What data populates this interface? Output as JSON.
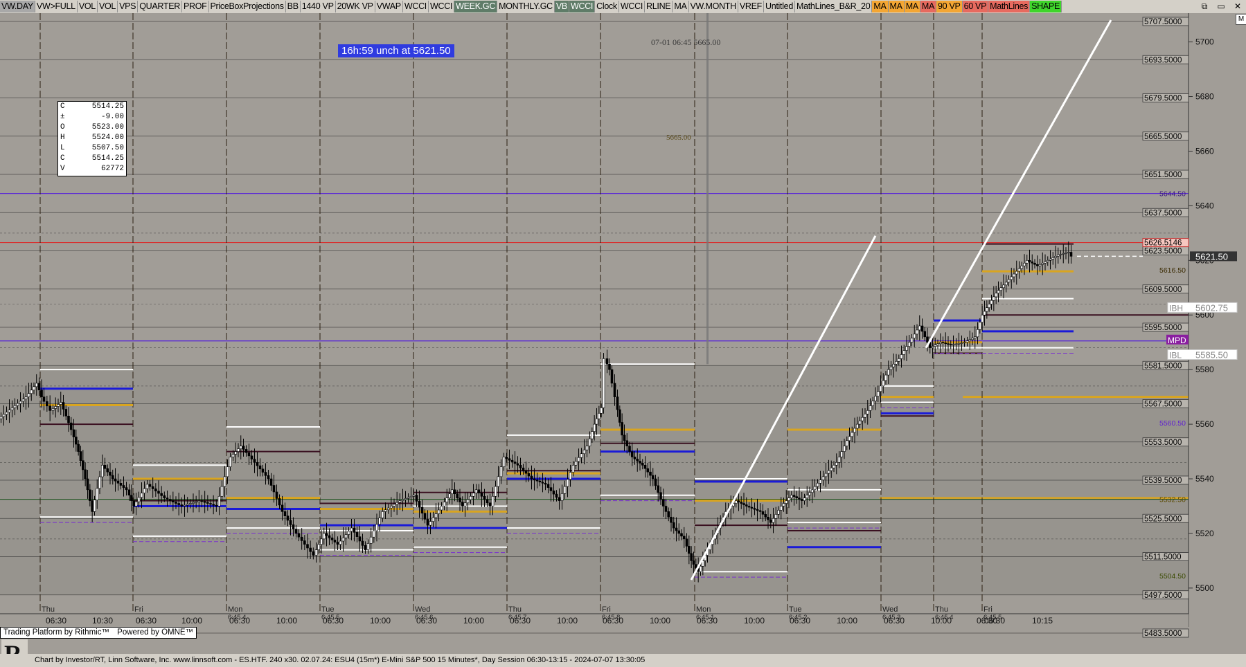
{
  "toolbar": {
    "buttons": [
      {
        "label": "VW.DAY",
        "style": "first"
      },
      {
        "label": "VW>FULL",
        "style": ""
      },
      {
        "label": "VOL",
        "style": ""
      },
      {
        "label": "VOL",
        "style": ""
      },
      {
        "label": "VPS",
        "style": ""
      },
      {
        "label": "QUARTER",
        "style": ""
      },
      {
        "label": "PROF",
        "style": ""
      },
      {
        "label": "PriceBoxProjections",
        "style": ""
      },
      {
        "label": "BB",
        "style": ""
      },
      {
        "label": "1440 VP",
        "style": ""
      },
      {
        "label": "20WK VP",
        "style": ""
      },
      {
        "label": "VWAP",
        "style": ""
      },
      {
        "label": "WCCI",
        "style": ""
      },
      {
        "label": "WCCI",
        "style": ""
      },
      {
        "label": "WEEK.GC",
        "style": "sel"
      },
      {
        "label": "MONTHLY.GC",
        "style": ""
      },
      {
        "label": "VB",
        "style": "sel"
      },
      {
        "label": "WCCI",
        "style": "sel"
      },
      {
        "label": "Clock",
        "style": ""
      },
      {
        "label": "WCCI",
        "style": ""
      },
      {
        "label": "RLINE",
        "style": ""
      },
      {
        "label": "MA",
        "style": ""
      },
      {
        "label": "VW.MONTH",
        "style": ""
      },
      {
        "label": "VREF",
        "style": ""
      },
      {
        "label": "Untitled",
        "style": ""
      },
      {
        "label": "MathLines_B&R_20",
        "style": ""
      },
      {
        "label": "MA",
        "style": "ora"
      },
      {
        "label": "MA",
        "style": "ora"
      },
      {
        "label": "MA",
        "style": "ora"
      },
      {
        "label": "MA",
        "style": "red"
      },
      {
        "label": "90 VP",
        "style": "ora"
      },
      {
        "label": "60 VP",
        "style": "red"
      },
      {
        "label": "MathLines",
        "style": "red"
      },
      {
        "label": "SHAPE",
        "style": "grn"
      }
    ],
    "window_controls": [
      "⧉",
      "▭",
      "✕"
    ]
  },
  "scale_button": "M",
  "timer_badge": "16h:59  unch at 5621.50",
  "annotation_top": "07-01 06:45  5665.00",
  "annotation_mid": "5665.00",
  "ohlc": [
    {
      "k": "C",
      "v": "5514.25"
    },
    {
      "k": "±",
      "v": "-9.00"
    },
    {
      "k": "O",
      "v": "5523.00"
    },
    {
      "k": "H",
      "v": "5524.00"
    },
    {
      "k": "L",
      "v": "5507.50"
    },
    {
      "k": "C",
      "v": "5514.25"
    },
    {
      "k": "V",
      "v": "62772"
    }
  ],
  "colors": {
    "bg_light": "#a19d97",
    "bg_dark": "#8f8c87",
    "white_line": "#ffffff",
    "gold": "#d9a520",
    "blue": "#1a1ad8",
    "purple": "#7a2fd0",
    "maroon": "#3a1020",
    "red_line": "#e02020",
    "violet_line": "#5a28d6"
  },
  "chart_data": {
    "type": "candlestick",
    "y_axis": {
      "min": 5483.5,
      "max": 5707.5,
      "ticks": [
        5500,
        5520,
        5540,
        5560,
        5580,
        5600,
        5620,
        5640,
        5660,
        5680,
        5700
      ]
    },
    "price_boxes": [
      "5707.5000",
      "5693.5000",
      "5679.5000",
      "5665.5000",
      "5651.5000",
      "5637.5000",
      "5623.5000",
      "5609.5000",
      "5595.5000",
      "5581.5000",
      "5567.5000",
      "5553.5000",
      "5539.5000",
      "5525.5000",
      "5511.5000",
      "5497.5000",
      "5483.5000"
    ],
    "level_labels": [
      {
        "price": 5644.5,
        "text": "5644.50",
        "color": "#3a1880"
      },
      {
        "price": 5616.5,
        "text": "5616.50",
        "color": "#3a2a00"
      },
      {
        "price": 5560.5,
        "text": "5560.50",
        "color": "#6020d0"
      },
      {
        "price": 5532.5,
        "text": "5532.50",
        "color": "#5a4a00"
      },
      {
        "price": 5504.5,
        "text": "5504.50",
        "color": "#3a4a00"
      }
    ],
    "red_box": {
      "price": 5626.5146,
      "text": "5626.5146"
    },
    "last_price": {
      "price": 5621.5,
      "text": "5621.50"
    },
    "ibh": {
      "label": "IBH",
      "price": 5602.75,
      "text": "5602.75"
    },
    "ibl": {
      "label": "IBL",
      "price": 5585.5,
      "text": "5585.50"
    },
    "mpd": {
      "label": "MPD",
      "price": 5591.0
    },
    "x_day_labels": [
      "Thu",
      "Fri",
      "Mon",
      "Tue",
      "Wed",
      "Thu",
      "Fri",
      "Mon",
      "Tue",
      "Wed",
      "Thu",
      "Fri"
    ],
    "x_time_labels": [
      "06:30",
      "10:30",
      "06:30",
      "10:00",
      "06:30",
      "10:00",
      "06:30",
      "10:00",
      "06:30",
      "10:00",
      "06:30",
      "10:00",
      "06:30",
      "10:00",
      "06:30",
      "10:00",
      "06:30",
      "10:00",
      "06:30",
      "10:00",
      "06:30",
      "06:30",
      "10:15"
    ],
    "x_sub_labels": [
      "6:45 4",
      "6:45 5",
      "6:45 6",
      "6:45 7",
      "6:45 8",
      "6:45 1",
      "6:45 2",
      "6:45 3",
      "6:45 4",
      "6:45 5"
    ],
    "series_path": [
      [
        0,
        5562
      ],
      [
        20,
        5566
      ],
      [
        40,
        5570
      ],
      [
        55,
        5575
      ],
      [
        62,
        5570
      ],
      [
        75,
        5565
      ],
      [
        90,
        5568
      ],
      [
        105,
        5558
      ],
      [
        115,
        5550
      ],
      [
        125,
        5540
      ],
      [
        135,
        5528
      ],
      [
        150,
        5545
      ],
      [
        165,
        5540
      ],
      [
        185,
        5536
      ],
      [
        195,
        5530
      ],
      [
        215,
        5538
      ],
      [
        240,
        5533
      ],
      [
        265,
        5530
      ],
      [
        290,
        5532
      ],
      [
        315,
        5530
      ],
      [
        335,
        5548
      ],
      [
        350,
        5552
      ],
      [
        370,
        5546
      ],
      [
        390,
        5540
      ],
      [
        410,
        5528
      ],
      [
        430,
        5520
      ],
      [
        455,
        5512
      ],
      [
        470,
        5520
      ],
      [
        490,
        5516
      ],
      [
        510,
        5522
      ],
      [
        530,
        5514
      ],
      [
        555,
        5528
      ],
      [
        580,
        5532
      ],
      [
        600,
        5534
      ],
      [
        620,
        5523
      ],
      [
        640,
        5530
      ],
      [
        655,
        5536
      ],
      [
        670,
        5530
      ],
      [
        690,
        5536
      ],
      [
        710,
        5530
      ],
      [
        730,
        5548
      ],
      [
        750,
        5545
      ],
      [
        770,
        5540
      ],
      [
        790,
        5538
      ],
      [
        810,
        5532
      ],
      [
        830,
        5545
      ],
      [
        850,
        5552
      ],
      [
        860,
        5560
      ],
      [
        870,
        5566
      ],
      [
        875,
        5584
      ],
      [
        882,
        5580
      ],
      [
        890,
        5570
      ],
      [
        900,
        5556
      ],
      [
        915,
        5548
      ],
      [
        930,
        5545
      ],
      [
        945,
        5540
      ],
      [
        960,
        5530
      ],
      [
        975,
        5522
      ],
      [
        990,
        5518
      ],
      [
        1000,
        5510
      ],
      [
        1010,
        5506
      ],
      [
        1020,
        5512
      ],
      [
        1035,
        5520
      ],
      [
        1050,
        5528
      ],
      [
        1065,
        5532
      ],
      [
        1080,
        5530
      ],
      [
        1100,
        5528
      ],
      [
        1115,
        5524
      ],
      [
        1130,
        5530
      ],
      [
        1145,
        5534
      ],
      [
        1160,
        5532
      ],
      [
        1175,
        5536
      ],
      [
        1195,
        5542
      ],
      [
        1210,
        5546
      ],
      [
        1225,
        5554
      ],
      [
        1240,
        5560
      ],
      [
        1255,
        5565
      ],
      [
        1270,
        5572
      ],
      [
        1285,
        5580
      ],
      [
        1300,
        5584
      ],
      [
        1315,
        5590
      ],
      [
        1330,
        5596
      ],
      [
        1345,
        5588
      ],
      [
        1360,
        5590
      ],
      [
        1375,
        5589
      ],
      [
        1395,
        5590
      ],
      [
        1410,
        5592
      ],
      [
        1420,
        5600
      ],
      [
        1430,
        5604
      ],
      [
        1440,
        5608
      ],
      [
        1455,
        5612
      ],
      [
        1470,
        5616
      ],
      [
        1485,
        5620
      ],
      [
        1500,
        5618
      ],
      [
        1515,
        5620
      ],
      [
        1530,
        5622
      ],
      [
        1545,
        5623
      ],
      [
        1550,
        5621.5
      ]
    ]
  },
  "brand": {
    "left": "Trading Platform by Rithmic™",
    "right": "Powered by OMNE™"
  },
  "footer_text": "Chart by Investor/RT, Linn Software, Inc. www.linnsoft.com - ES.HTF.  240 x30.   02.07.24: ESU4 (15m*) E-Mini S&P 500 15 Minutes*, Day Session 06:30-13:15 - 2024-07-07 13:30:05"
}
